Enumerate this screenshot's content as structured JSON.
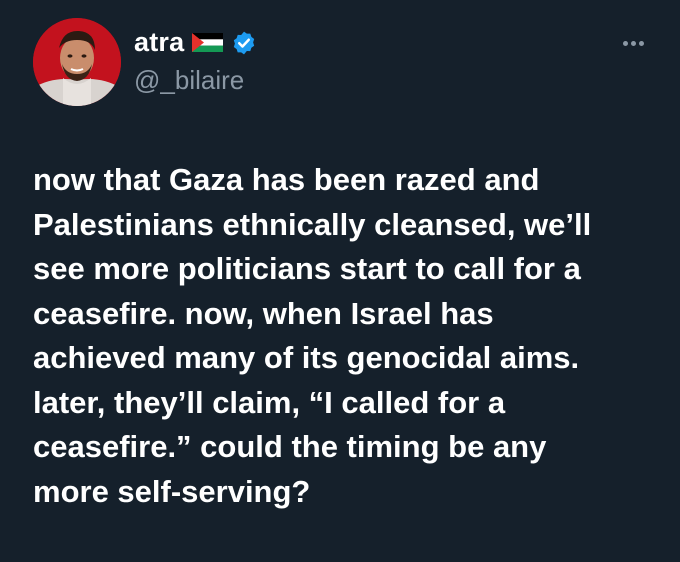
{
  "author": {
    "display_name": "atra",
    "handle": "@_bilaire",
    "flag_icon": "palestine-flag-icon",
    "verified_icon": "verified-badge-icon",
    "verified_color": "#1d9bf0"
  },
  "tweet": {
    "lines": [
      "now that Gaza has been razed and",
      "Palestinians ethnically cleansed, we’ll",
      "see more politicians start to call for a",
      "ceasefire. now, when Israel has",
      "achieved many of its genocidal aims.",
      "later, they’ll claim, “I called for a",
      "ceasefire.” could the timing be any",
      "more self-serving?"
    ]
  },
  "theme": {
    "background": "#15202b",
    "text": "#ffffff",
    "secondary_text": "#8b98a5"
  }
}
